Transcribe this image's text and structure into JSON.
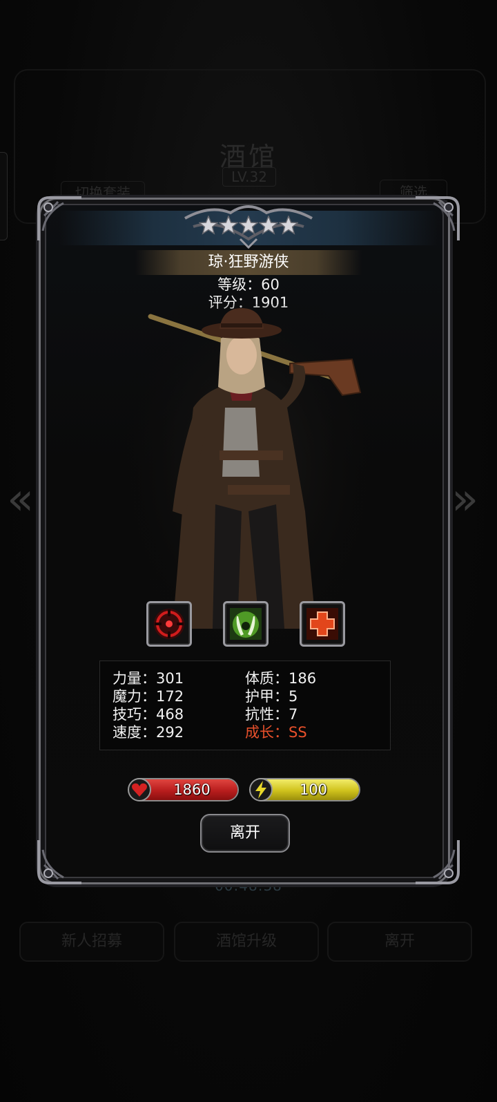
{
  "background": {
    "title": "酒馆",
    "level": "LV.32",
    "switch_button": "切换套装",
    "filter_button": "筛选",
    "timer": "00:48:38",
    "bottom_buttons": [
      "新人招募",
      "酒馆升级",
      "离开"
    ],
    "arrow_left": "«",
    "arrow_right": "»"
  },
  "hero": {
    "stars": 5,
    "name": "琼·狂野游侠",
    "level_text": "等级：60",
    "score_text": "评分：1901"
  },
  "skills": [
    {
      "icon": "crosshair-skill-icon",
      "color": "#c8181a"
    },
    {
      "icon": "green-beast-skill-icon",
      "color": "#5aa52a"
    },
    {
      "icon": "red-cross-skill-icon",
      "color": "#e2461b"
    }
  ],
  "stats": {
    "left": [
      "力量：301",
      "魔力：172",
      "技巧：468",
      "速度：292"
    ],
    "right": [
      "体质：186",
      "护甲：5",
      "抗性：7"
    ],
    "growth": "成长：SS"
  },
  "bars": {
    "hp": {
      "value": "1860",
      "fill": 1.0,
      "color": "#c2221f",
      "icon": "heart-icon"
    },
    "energy": {
      "value": "100",
      "fill": 1.0,
      "color": "#d8cc22",
      "icon": "lightning-icon"
    }
  },
  "dialog": {
    "leave_label": "离开"
  }
}
